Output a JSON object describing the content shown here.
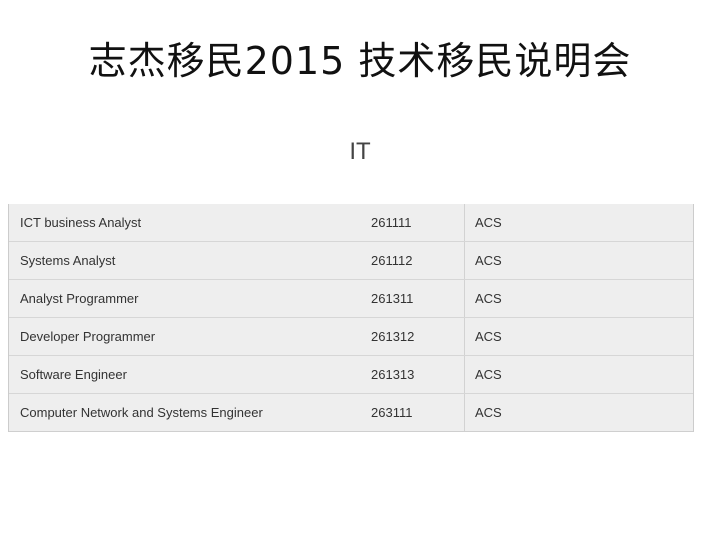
{
  "slide": {
    "title": "志杰移民2015 技术移民说明会",
    "subtitle": "IT"
  },
  "table": {
    "rows": [
      {
        "occupation": "ICT business Analyst",
        "code": "261111",
        "assessing_body": "ACS"
      },
      {
        "occupation": "Systems Analyst",
        "code": "261112",
        "assessing_body": "ACS"
      },
      {
        "occupation": "Analyst Programmer",
        "code": "261311",
        "assessing_body": "ACS"
      },
      {
        "occupation": "Developer Programmer",
        "code": "261312",
        "assessing_body": "ACS"
      },
      {
        "occupation": "Software Engineer",
        "code": "261313",
        "assessing_body": "ACS"
      },
      {
        "occupation": "Computer Network and Systems Engineer",
        "code": "263111",
        "assessing_body": "ACS"
      }
    ]
  }
}
